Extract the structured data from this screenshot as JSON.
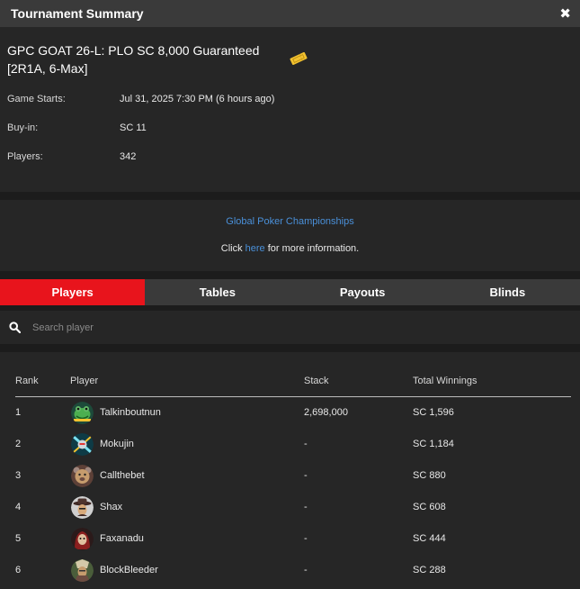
{
  "window": {
    "title": "Tournament Summary",
    "close_glyph": "✖"
  },
  "tournament": {
    "name": "GPC GOAT 26-L: PLO SC 8,000 Guaranteed [2R1A, 6-Max]",
    "icon": "ticket-icon",
    "details": [
      {
        "label": "Game Starts:",
        "value": "Jul 31, 2025 7:30 PM (6 hours ago)"
      },
      {
        "label": "Buy-in:",
        "value": "SC 11"
      },
      {
        "label": "Players:",
        "value": "342"
      }
    ]
  },
  "info_link": {
    "organizer": "Global Poker Championships",
    "prefix": "Click",
    "link_text": "here",
    "suffix": "for more information."
  },
  "tabs": [
    {
      "label": "Players",
      "active": true
    },
    {
      "label": "Tables",
      "active": false
    },
    {
      "label": "Payouts",
      "active": false
    },
    {
      "label": "Blinds",
      "active": false
    }
  ],
  "search": {
    "placeholder": "Search player",
    "value": ""
  },
  "table": {
    "headers": {
      "rank": "Rank",
      "player": "Player",
      "stack": "Stack",
      "winnings": "Total Winnings"
    },
    "rows": [
      {
        "rank": "1",
        "player": "Talkinboutnun",
        "stack": "2,698,000",
        "winnings": "SC 1,596",
        "avatar": "frog-avatar"
      },
      {
        "rank": "2",
        "player": "Mokujin",
        "stack": "-",
        "winnings": "SC 1,184",
        "avatar": "robot-avatar"
      },
      {
        "rank": "3",
        "player": "Callthebet",
        "stack": "-",
        "winnings": "SC 880",
        "avatar": "bear-avatar"
      },
      {
        "rank": "4",
        "player": "Shax",
        "stack": "-",
        "winnings": "SC 608",
        "avatar": "cowboy-avatar"
      },
      {
        "rank": "5",
        "player": "Faxanadu",
        "stack": "-",
        "winnings": "SC 444",
        "avatar": "hooded-avatar"
      },
      {
        "rank": "6",
        "player": "BlockBleeder",
        "stack": "-",
        "winnings": "SC 288",
        "avatar": "warrior-avatar"
      }
    ]
  },
  "colors": {
    "accent": "#e8141c",
    "link": "#4a90d9",
    "panel": "#262626",
    "background": "#1c1c1c",
    "titlebar": "#3a3a3a"
  }
}
